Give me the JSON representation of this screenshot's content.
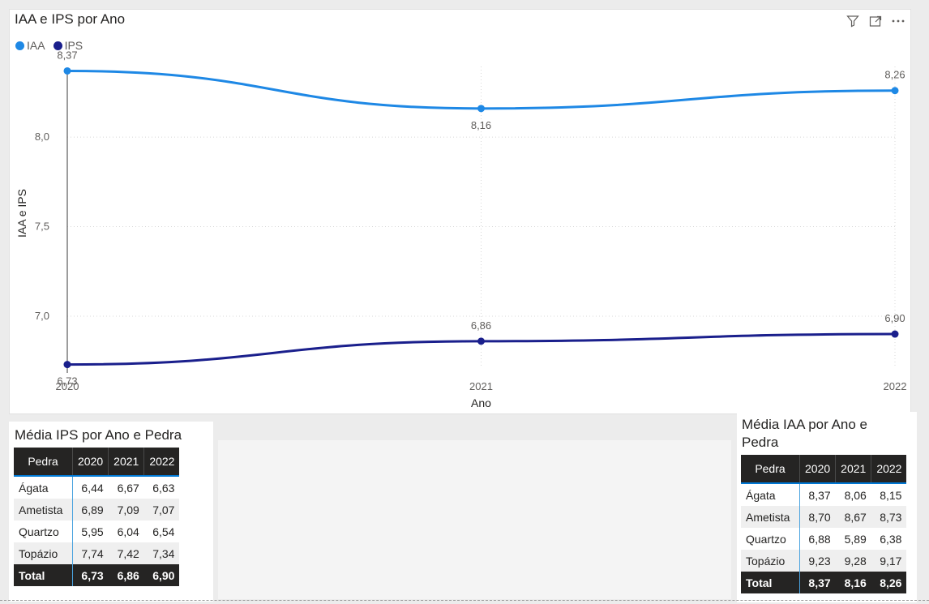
{
  "colors": {
    "iaa": "#1e88e5",
    "ips": "#1a1f8c",
    "header_bg": "#252423"
  },
  "chart": {
    "title": "IAA e IPS por Ano"
  },
  "header_icons": [
    "filter-icon",
    "focus-mode-icon",
    "more-options-icon"
  ],
  "chart_data": {
    "type": "line",
    "title": "IAA e IPS por Ano",
    "xlabel": "Ano",
    "ylabel": "IAA e IPS",
    "categories": [
      "2020",
      "2021",
      "2022"
    ],
    "series": [
      {
        "name": "IAA",
        "values": [
          8.37,
          8.16,
          8.26
        ],
        "labels": [
          "8,37",
          "8,16",
          "8,26"
        ]
      },
      {
        "name": "IPS",
        "values": [
          6.73,
          6.86,
          6.9
        ],
        "labels": [
          "6,73",
          "6,86",
          "6,90"
        ]
      }
    ],
    "y_ticks": [
      7.0,
      7.5,
      8.0
    ],
    "y_tick_labels": [
      "7,0",
      "7,5",
      "8,0"
    ],
    "ylim": [
      6.71,
      8.44
    ],
    "grid": true,
    "legend_position": "top-left"
  },
  "table_ips": {
    "title": "Média IPS por Ano e Pedra",
    "headers": [
      "Pedra",
      "2020",
      "2021",
      "2022"
    ],
    "rows": [
      [
        "Ágata",
        "6,44",
        "6,67",
        "6,63"
      ],
      [
        "Ametista",
        "6,89",
        "7,09",
        "7,07"
      ],
      [
        "Quartzo",
        "5,95",
        "6,04",
        "6,54"
      ],
      [
        "Topázio",
        "7,74",
        "7,42",
        "7,34"
      ]
    ],
    "total": [
      "Total",
      "6,73",
      "6,86",
      "6,90"
    ]
  },
  "table_iaa": {
    "title": "Média IAA por Ano e Pedra",
    "headers": [
      "Pedra",
      "2020",
      "2021",
      "2022"
    ],
    "rows": [
      [
        "Ágata",
        "8,37",
        "8,06",
        "8,15"
      ],
      [
        "Ametista",
        "8,70",
        "8,67",
        "8,73"
      ],
      [
        "Quartzo",
        "6,88",
        "5,89",
        "6,38"
      ],
      [
        "Topázio",
        "9,23",
        "9,28",
        "9,17"
      ]
    ],
    "total": [
      "Total",
      "8,37",
      "8,16",
      "8,26"
    ]
  }
}
